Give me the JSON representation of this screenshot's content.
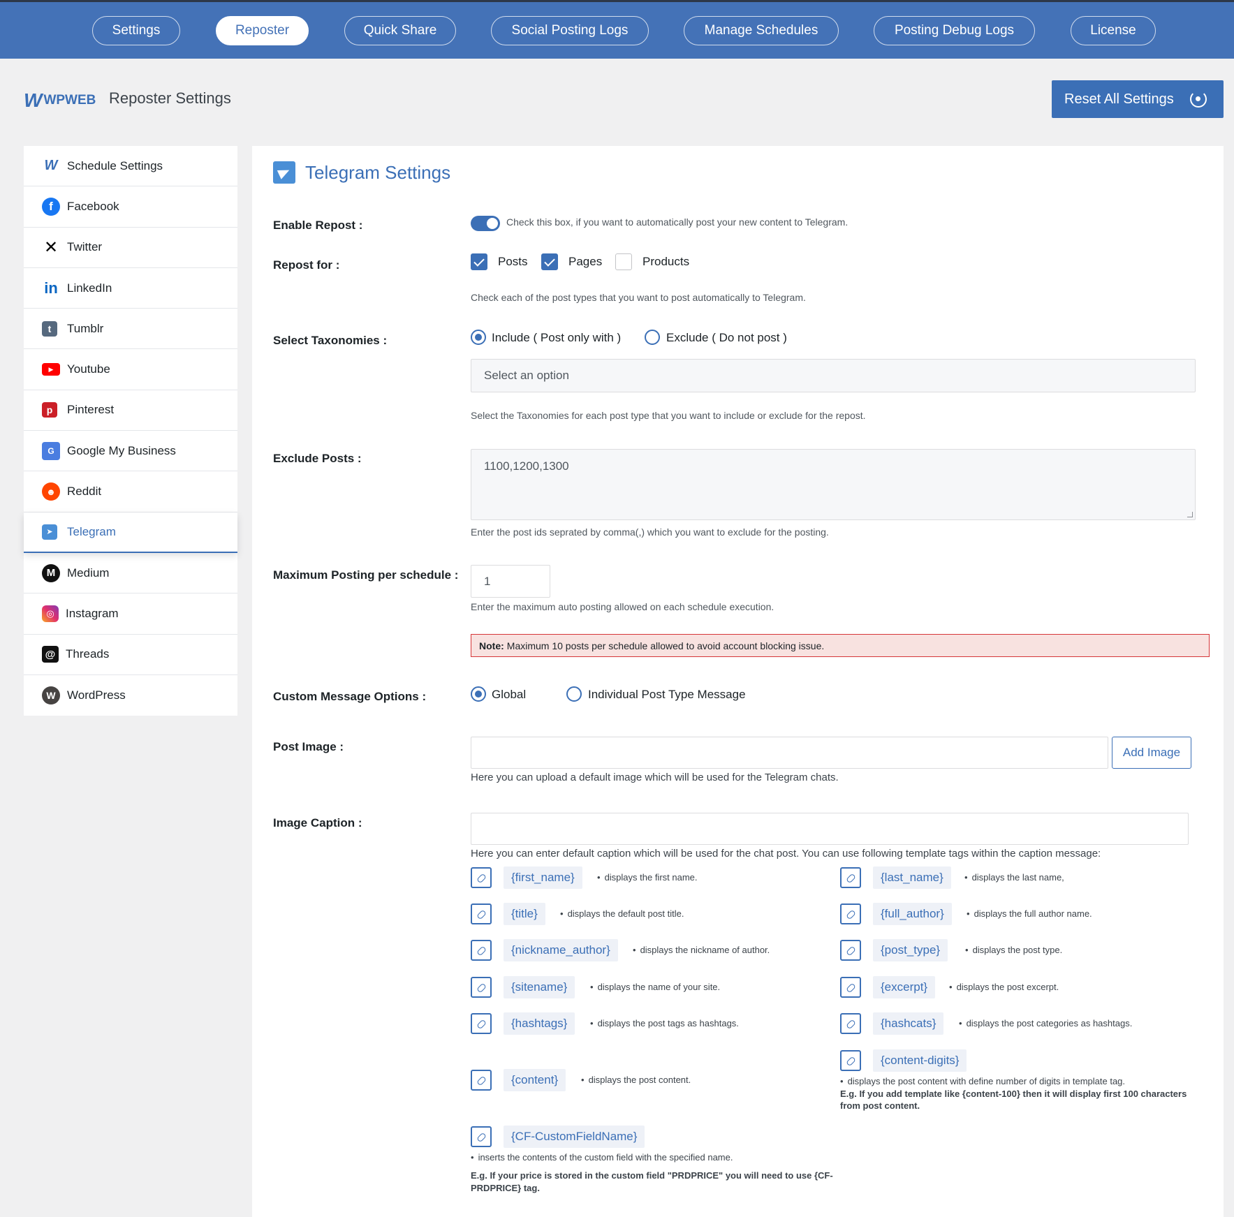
{
  "topnav": {
    "tabs": [
      {
        "label": "Settings"
      },
      {
        "label": "Reposter",
        "active": true
      },
      {
        "label": "Quick Share"
      },
      {
        "label": "Social Posting Logs"
      },
      {
        "label": "Manage Schedules"
      },
      {
        "label": "Posting Debug Logs"
      },
      {
        "label": "License"
      }
    ]
  },
  "header": {
    "logo_w": "W",
    "logo_word": "WPWEB",
    "title": "Reposter Settings",
    "reset_label": "Reset All Settings"
  },
  "sidebar": {
    "items": [
      {
        "label": "Schedule Settings",
        "icon": "wpweb-icon"
      },
      {
        "label": "Facebook",
        "icon": "facebook-icon"
      },
      {
        "label": "Twitter",
        "icon": "x-icon"
      },
      {
        "label": "LinkedIn",
        "icon": "linkedin-icon"
      },
      {
        "label": "Tumblr",
        "icon": "tumblr-icon"
      },
      {
        "label": "Youtube",
        "icon": "youtube-icon"
      },
      {
        "label": "Pinterest",
        "icon": "pinterest-icon"
      },
      {
        "label": "Google My Business",
        "icon": "google-business-icon"
      },
      {
        "label": "Reddit",
        "icon": "reddit-icon"
      },
      {
        "label": "Telegram",
        "icon": "telegram-icon",
        "active": true
      },
      {
        "label": "Medium",
        "icon": "medium-icon"
      },
      {
        "label": "Instagram",
        "icon": "instagram-icon"
      },
      {
        "label": "Threads",
        "icon": "threads-icon"
      },
      {
        "label": "WordPress",
        "icon": "wordpress-icon"
      }
    ]
  },
  "panel": {
    "title": "Telegram Settings",
    "enable_repost": {
      "label": "Enable Repost :",
      "enabled": true,
      "help": "Check this box, if you want to automatically post your new content to Telegram."
    },
    "repost_for": {
      "label": "Repost for :",
      "options": [
        {
          "label": "Posts",
          "checked": true
        },
        {
          "label": "Pages",
          "checked": true
        },
        {
          "label": "Products",
          "checked": false
        }
      ],
      "help": "Check each of the post types that you want to post automatically to Telegram."
    },
    "taxonomies": {
      "label": "Select Taxonomies :",
      "include_label": "Include ( Post only with )",
      "exclude_label": "Exclude ( Do not post )",
      "selected": "include",
      "select_placeholder": "Select an option",
      "help": "Select the Taxonomies for each post type that you want to include or exclude for the repost."
    },
    "exclude_posts": {
      "label": "Exclude Posts :",
      "value": "1100,1200,1300",
      "help": "Enter the post ids seprated by comma(,) which you want to exclude for the posting."
    },
    "max_posting": {
      "label": "Maximum Posting per schedule :",
      "value": "1",
      "help": "Enter the maximum auto posting allowed on each schedule execution.",
      "note_bold": "Note:",
      "note_text": "Maximum 10 posts per schedule allowed to avoid account blocking issue."
    },
    "custom_message": {
      "label": "Custom Message Options :",
      "global_label": "Global",
      "individual_label": "Individual Post Type Message",
      "selected": "global"
    },
    "post_image": {
      "label": "Post Image :",
      "value": "",
      "button": "Add Image",
      "help": "Here you can upload a default image which will be used for the Telegram chats."
    },
    "image_caption": {
      "label": "Image Caption :",
      "value": "",
      "help": "Here you can enter default caption which will be used for the chat post. You can use following template tags within the caption message:"
    },
    "tags": {
      "first_name": {
        "tag": "{first_name}",
        "desc": "displays the first name."
      },
      "last_name": {
        "tag": "{last_name}",
        "desc": "displays the last name,"
      },
      "title": {
        "tag": "{title}",
        "desc": "displays the default post title."
      },
      "full_author": {
        "tag": "{full_author}",
        "desc": "displays the full author name."
      },
      "nickname_author": {
        "tag": "{nickname_author}",
        "desc": "displays the nickname of author."
      },
      "post_type": {
        "tag": "{post_type}",
        "desc": "displays the post type."
      },
      "sitename": {
        "tag": "{sitename}",
        "desc": "displays the name of your site."
      },
      "excerpt": {
        "tag": "{excerpt}",
        "desc": "displays the post excerpt."
      },
      "hashtags": {
        "tag": "{hashtags}",
        "desc": "displays the post tags as hashtags."
      },
      "hashcats": {
        "tag": "{hashcats}",
        "desc": "displays the post categories as hashtags."
      },
      "content_digits": {
        "tag": "{content-digits}",
        "desc": "displays the post content with define number of digits in template tag.",
        "example": "E.g. If you add template like {content-100} then it will display first 100 characters from post content."
      },
      "content": {
        "tag": "{content}",
        "desc": "displays the post content."
      },
      "custom_field": {
        "tag": "{CF-CustomFieldName}",
        "desc": "inserts the contents of the custom field with the specified name.",
        "example": "E.g. If your price is stored in the custom field \"PRDPRICE\" you will need to use {CF-PRDPRICE} tag."
      }
    }
  }
}
